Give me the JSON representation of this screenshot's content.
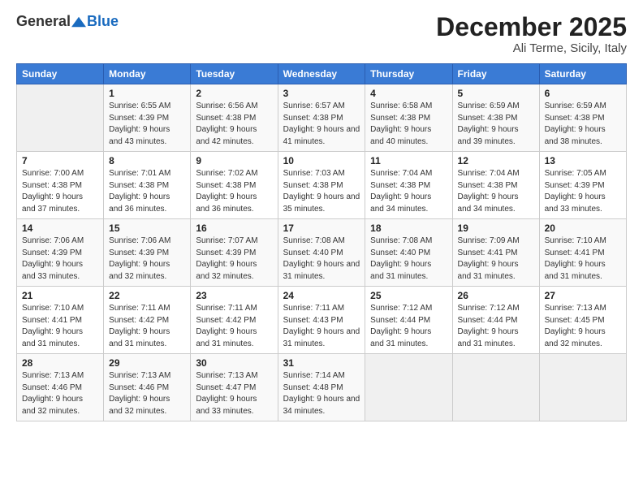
{
  "header": {
    "logo_general": "General",
    "logo_blue": "Blue",
    "month_title": "December 2025",
    "location": "Ali Terme, Sicily, Italy"
  },
  "weekdays": [
    "Sunday",
    "Monday",
    "Tuesday",
    "Wednesday",
    "Thursday",
    "Friday",
    "Saturday"
  ],
  "weeks": [
    [
      {
        "day": "",
        "sunrise": "",
        "sunset": "",
        "daylight": ""
      },
      {
        "day": "1",
        "sunrise": "Sunrise: 6:55 AM",
        "sunset": "Sunset: 4:39 PM",
        "daylight": "Daylight: 9 hours and 43 minutes."
      },
      {
        "day": "2",
        "sunrise": "Sunrise: 6:56 AM",
        "sunset": "Sunset: 4:38 PM",
        "daylight": "Daylight: 9 hours and 42 minutes."
      },
      {
        "day": "3",
        "sunrise": "Sunrise: 6:57 AM",
        "sunset": "Sunset: 4:38 PM",
        "daylight": "Daylight: 9 hours and 41 minutes."
      },
      {
        "day": "4",
        "sunrise": "Sunrise: 6:58 AM",
        "sunset": "Sunset: 4:38 PM",
        "daylight": "Daylight: 9 hours and 40 minutes."
      },
      {
        "day": "5",
        "sunrise": "Sunrise: 6:59 AM",
        "sunset": "Sunset: 4:38 PM",
        "daylight": "Daylight: 9 hours and 39 minutes."
      },
      {
        "day": "6",
        "sunrise": "Sunrise: 6:59 AM",
        "sunset": "Sunset: 4:38 PM",
        "daylight": "Daylight: 9 hours and 38 minutes."
      }
    ],
    [
      {
        "day": "7",
        "sunrise": "Sunrise: 7:00 AM",
        "sunset": "Sunset: 4:38 PM",
        "daylight": "Daylight: 9 hours and 37 minutes."
      },
      {
        "day": "8",
        "sunrise": "Sunrise: 7:01 AM",
        "sunset": "Sunset: 4:38 PM",
        "daylight": "Daylight: 9 hours and 36 minutes."
      },
      {
        "day": "9",
        "sunrise": "Sunrise: 7:02 AM",
        "sunset": "Sunset: 4:38 PM",
        "daylight": "Daylight: 9 hours and 36 minutes."
      },
      {
        "day": "10",
        "sunrise": "Sunrise: 7:03 AM",
        "sunset": "Sunset: 4:38 PM",
        "daylight": "Daylight: 9 hours and 35 minutes."
      },
      {
        "day": "11",
        "sunrise": "Sunrise: 7:04 AM",
        "sunset": "Sunset: 4:38 PM",
        "daylight": "Daylight: 9 hours and 34 minutes."
      },
      {
        "day": "12",
        "sunrise": "Sunrise: 7:04 AM",
        "sunset": "Sunset: 4:38 PM",
        "daylight": "Daylight: 9 hours and 34 minutes."
      },
      {
        "day": "13",
        "sunrise": "Sunrise: 7:05 AM",
        "sunset": "Sunset: 4:39 PM",
        "daylight": "Daylight: 9 hours and 33 minutes."
      }
    ],
    [
      {
        "day": "14",
        "sunrise": "Sunrise: 7:06 AM",
        "sunset": "Sunset: 4:39 PM",
        "daylight": "Daylight: 9 hours and 33 minutes."
      },
      {
        "day": "15",
        "sunrise": "Sunrise: 7:06 AM",
        "sunset": "Sunset: 4:39 PM",
        "daylight": "Daylight: 9 hours and 32 minutes."
      },
      {
        "day": "16",
        "sunrise": "Sunrise: 7:07 AM",
        "sunset": "Sunset: 4:39 PM",
        "daylight": "Daylight: 9 hours and 32 minutes."
      },
      {
        "day": "17",
        "sunrise": "Sunrise: 7:08 AM",
        "sunset": "Sunset: 4:40 PM",
        "daylight": "Daylight: 9 hours and 31 minutes."
      },
      {
        "day": "18",
        "sunrise": "Sunrise: 7:08 AM",
        "sunset": "Sunset: 4:40 PM",
        "daylight": "Daylight: 9 hours and 31 minutes."
      },
      {
        "day": "19",
        "sunrise": "Sunrise: 7:09 AM",
        "sunset": "Sunset: 4:41 PM",
        "daylight": "Daylight: 9 hours and 31 minutes."
      },
      {
        "day": "20",
        "sunrise": "Sunrise: 7:10 AM",
        "sunset": "Sunset: 4:41 PM",
        "daylight": "Daylight: 9 hours and 31 minutes."
      }
    ],
    [
      {
        "day": "21",
        "sunrise": "Sunrise: 7:10 AM",
        "sunset": "Sunset: 4:41 PM",
        "daylight": "Daylight: 9 hours and 31 minutes."
      },
      {
        "day": "22",
        "sunrise": "Sunrise: 7:11 AM",
        "sunset": "Sunset: 4:42 PM",
        "daylight": "Daylight: 9 hours and 31 minutes."
      },
      {
        "day": "23",
        "sunrise": "Sunrise: 7:11 AM",
        "sunset": "Sunset: 4:42 PM",
        "daylight": "Daylight: 9 hours and 31 minutes."
      },
      {
        "day": "24",
        "sunrise": "Sunrise: 7:11 AM",
        "sunset": "Sunset: 4:43 PM",
        "daylight": "Daylight: 9 hours and 31 minutes."
      },
      {
        "day": "25",
        "sunrise": "Sunrise: 7:12 AM",
        "sunset": "Sunset: 4:44 PM",
        "daylight": "Daylight: 9 hours and 31 minutes."
      },
      {
        "day": "26",
        "sunrise": "Sunrise: 7:12 AM",
        "sunset": "Sunset: 4:44 PM",
        "daylight": "Daylight: 9 hours and 31 minutes."
      },
      {
        "day": "27",
        "sunrise": "Sunrise: 7:13 AM",
        "sunset": "Sunset: 4:45 PM",
        "daylight": "Daylight: 9 hours and 32 minutes."
      }
    ],
    [
      {
        "day": "28",
        "sunrise": "Sunrise: 7:13 AM",
        "sunset": "Sunset: 4:46 PM",
        "daylight": "Daylight: 9 hours and 32 minutes."
      },
      {
        "day": "29",
        "sunrise": "Sunrise: 7:13 AM",
        "sunset": "Sunset: 4:46 PM",
        "daylight": "Daylight: 9 hours and 32 minutes."
      },
      {
        "day": "30",
        "sunrise": "Sunrise: 7:13 AM",
        "sunset": "Sunset: 4:47 PM",
        "daylight": "Daylight: 9 hours and 33 minutes."
      },
      {
        "day": "31",
        "sunrise": "Sunrise: 7:14 AM",
        "sunset": "Sunset: 4:48 PM",
        "daylight": "Daylight: 9 hours and 34 minutes."
      },
      {
        "day": "",
        "sunrise": "",
        "sunset": "",
        "daylight": ""
      },
      {
        "day": "",
        "sunrise": "",
        "sunset": "",
        "daylight": ""
      },
      {
        "day": "",
        "sunrise": "",
        "sunset": "",
        "daylight": ""
      }
    ]
  ]
}
